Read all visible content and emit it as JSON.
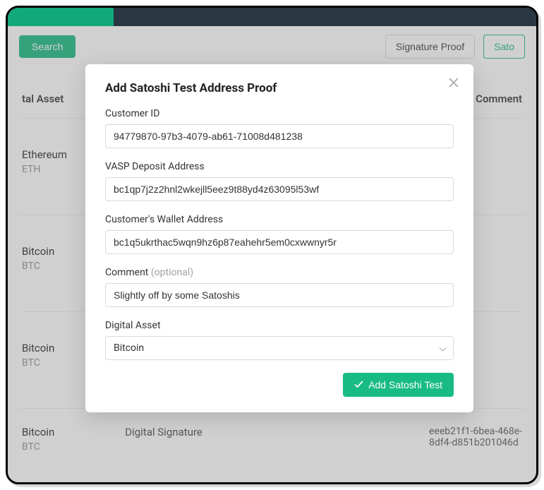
{
  "toolbar": {
    "search_label": "Search",
    "sig_proof_label": "Signature Proof",
    "satoshi_label_partial": "Sato"
  },
  "table": {
    "header_asset": "tal Asset",
    "header_comment": "Comment",
    "rows": [
      {
        "name": "Ethereum",
        "ticker": "ETH"
      },
      {
        "name": "Bitcoin",
        "ticker": "BTC"
      },
      {
        "name": "Bitcoin",
        "ticker": "BTC"
      },
      {
        "name": "Bitcoin",
        "ticker": "BTC"
      }
    ],
    "sig_label": "Digital Signature",
    "sig_value_line1": "eeeb21f1-6bea-468e-",
    "sig_value_line2": "8df4-d851b201046d"
  },
  "modal": {
    "title": "Add Satoshi Test Address Proof",
    "customer_id_label": "Customer ID",
    "customer_id_value": "94779870-97b3-4079-ab61-71008d481238",
    "vasp_label": "VASP Deposit Address",
    "vasp_value": "bc1qp7j2z2hnl2wkejll5eez9t88yd4z63095l53wf",
    "wallet_label": "Customer's Wallet Address",
    "wallet_value": "bc1q5ukrthac5wqn9hz6p87eahehr5em0cxwwnyr5r",
    "comment_label": "Comment ",
    "comment_optional": "(optional)",
    "comment_value": "Slightly off by some Satoshis",
    "asset_label": "Digital Asset",
    "asset_value": "Bitcoin",
    "submit_label": "Add Satoshi Test"
  }
}
